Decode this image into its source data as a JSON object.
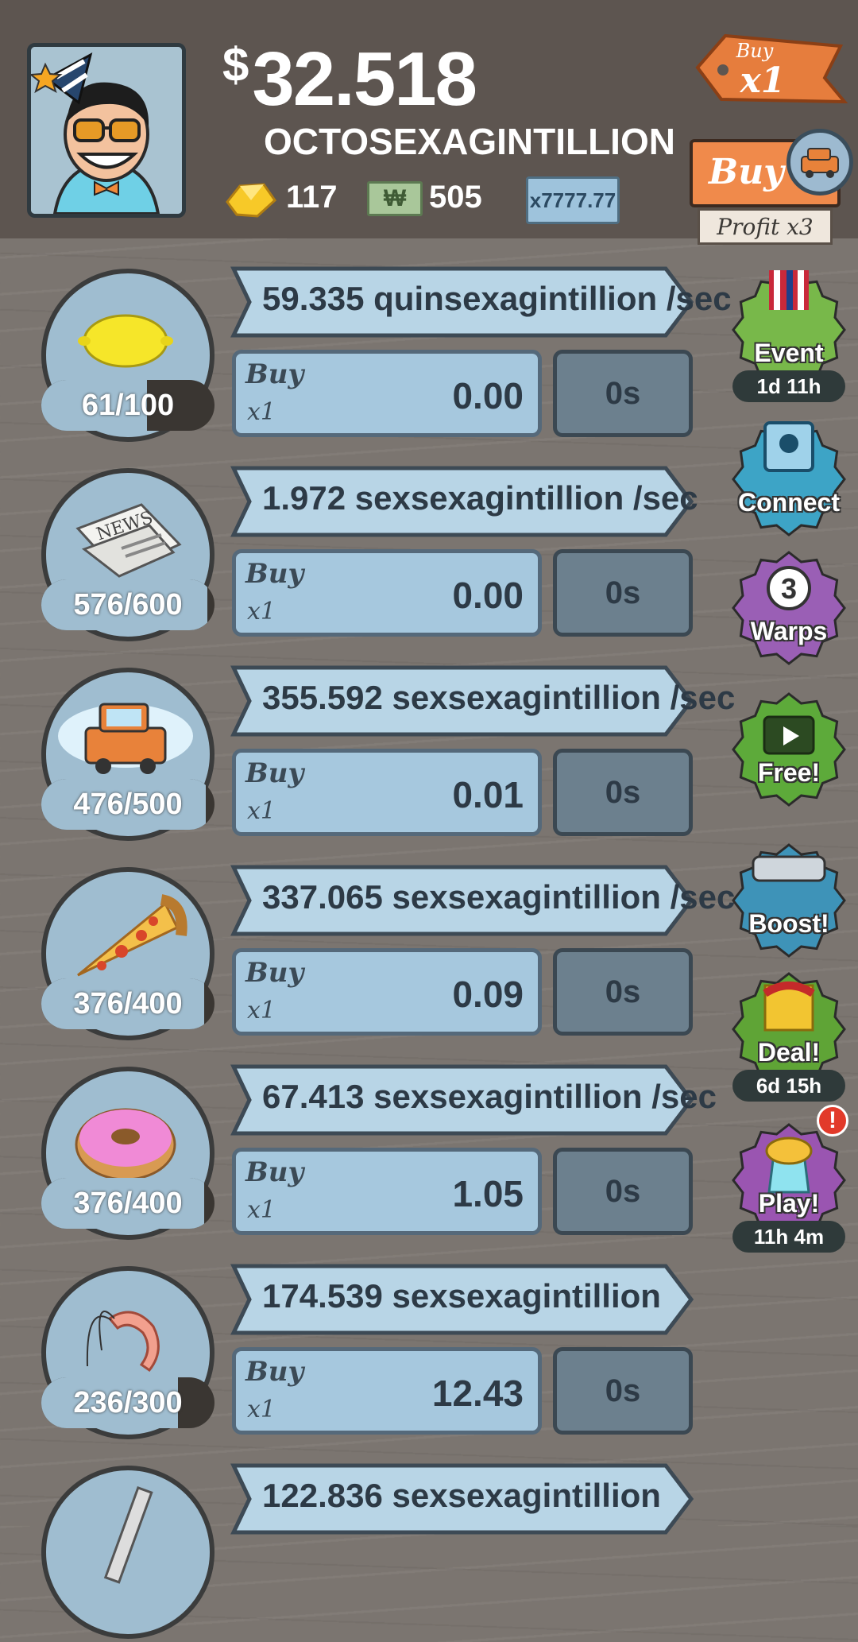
{
  "header": {
    "currency_symbol": "$",
    "money": "32.518",
    "money_unit": "OCTOSEXAGINTILLION",
    "gold": "117",
    "megabucks_symbol": "₩",
    "megabucks": "505",
    "multiplier": "x7777.77",
    "buy_tag_top": "Buy",
    "buy_tag_amount": "x1",
    "buy_button": "Buy",
    "profit_label": "Profit x3"
  },
  "businesses": [
    {
      "icon": "lemon-icon",
      "rate": "59.335 quinsexagintillion /sec",
      "owned": "61/100",
      "progress": 0.61,
      "buy": "Buy",
      "qty": "x1",
      "cost": "0.00",
      "timer": "0s"
    },
    {
      "icon": "newspaper-icon",
      "news_text": "NEWS",
      "rate": "1.972 sexsexagintillion /sec",
      "owned": "576/600",
      "progress": 0.96,
      "buy": "Buy",
      "qty": "x1",
      "cost": "0.00",
      "timer": "0s"
    },
    {
      "icon": "car-icon",
      "rate": "355.592 sexsexagintillion /sec",
      "owned": "476/500",
      "progress": 0.95,
      "buy": "Buy",
      "qty": "x1",
      "cost": "0.01",
      "timer": "0s"
    },
    {
      "icon": "pizza-icon",
      "rate": "337.065 sexsexagintillion /sec",
      "owned": "376/400",
      "progress": 0.94,
      "buy": "Buy",
      "qty": "x1",
      "cost": "0.09",
      "timer": "0s"
    },
    {
      "icon": "donut-icon",
      "rate": "67.413 sexsexagintillion /sec",
      "owned": "376/400",
      "progress": 0.94,
      "buy": "Buy",
      "qty": "x1",
      "cost": "1.05",
      "timer": "0s"
    },
    {
      "icon": "shrimp-icon",
      "rate": "174.539 sexsexagintillion",
      "owned": "236/300",
      "progress": 0.79,
      "buy": "Buy",
      "qty": "x1",
      "cost": "12.43",
      "timer": "0s"
    },
    {
      "icon": "hockey-stick-icon",
      "rate": "122.836 sexsexagintillion"
    }
  ],
  "side_buttons": [
    {
      "name": "event",
      "label": "Event",
      "time": "1d 11h",
      "color": "#78b84a"
    },
    {
      "name": "connect",
      "label": "Connect",
      "color": "#3da4c6"
    },
    {
      "name": "warps",
      "label": "Warps",
      "count": "3",
      "color": "#9a5fb5"
    },
    {
      "name": "free",
      "label": "Free!",
      "color": "#5daa3a"
    },
    {
      "name": "boost",
      "label": "Boost!",
      "color": "#3e93b8"
    },
    {
      "name": "deal",
      "label": "Deal!",
      "time": "6d 15h",
      "color": "#5fa436"
    },
    {
      "name": "play",
      "label": "Play!",
      "time": "11h 4m",
      "color": "#9a55b1",
      "alert": "!"
    }
  ]
}
